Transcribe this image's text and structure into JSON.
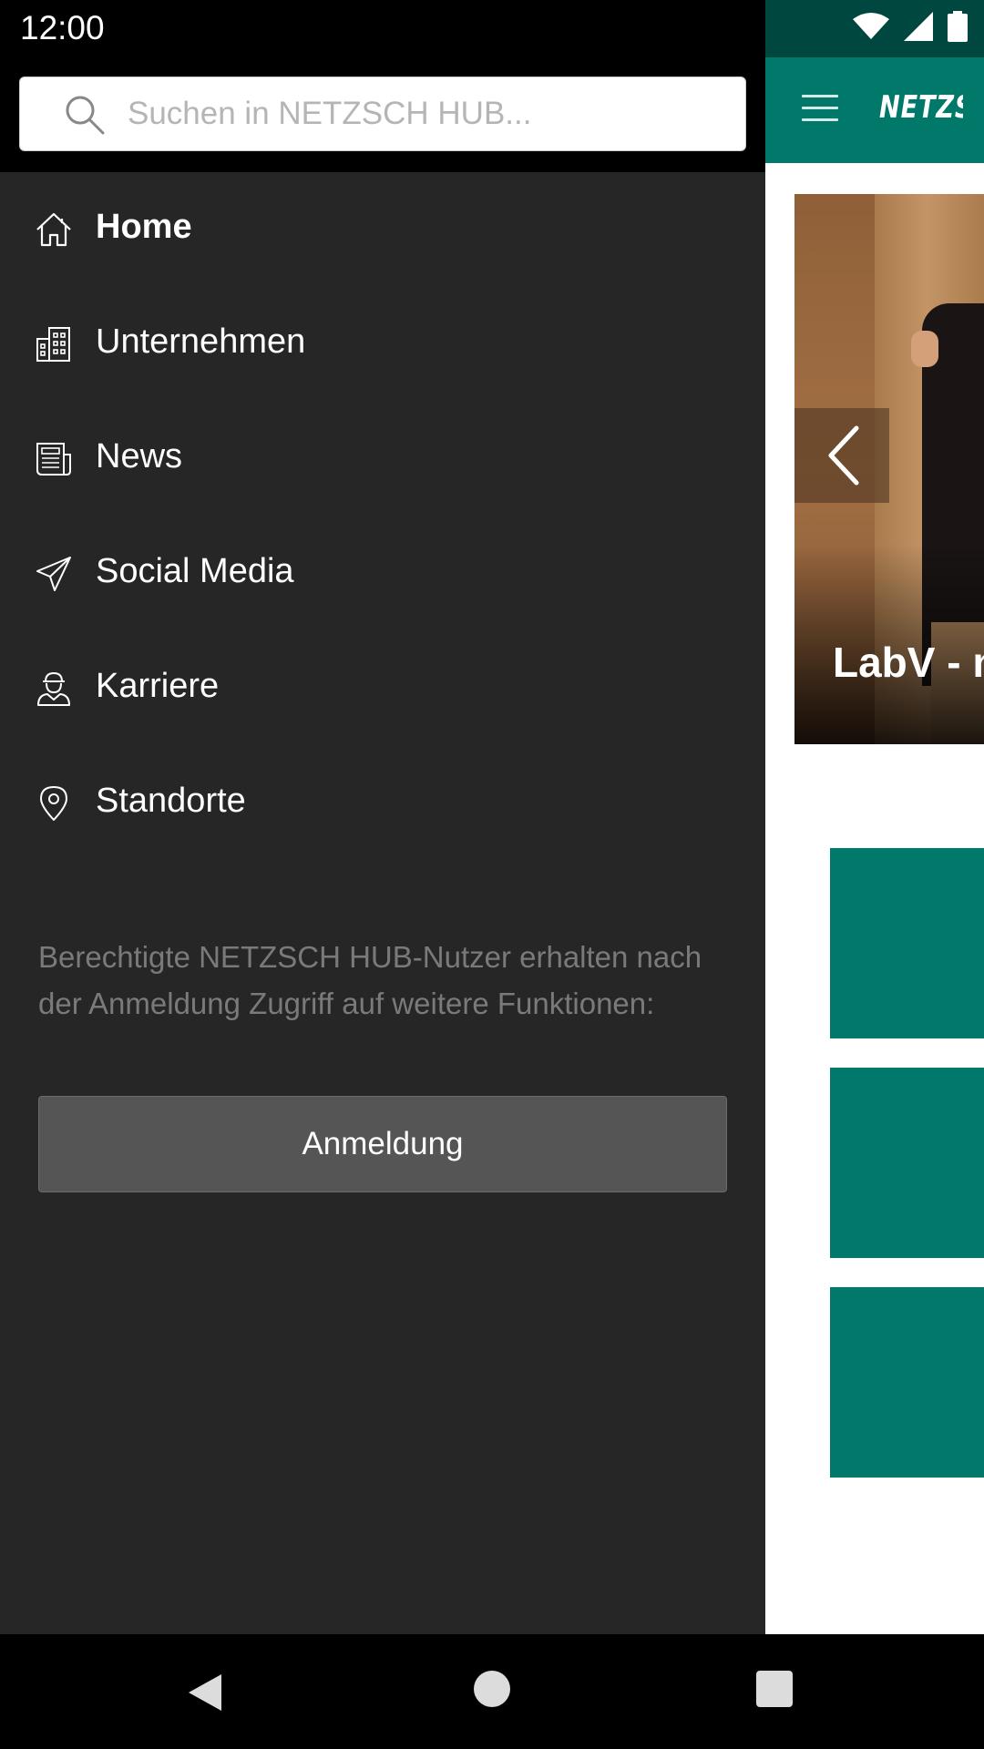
{
  "status_bar": {
    "time": "12:00"
  },
  "app": {
    "brand": "NETZSCH",
    "banner_title": "LabV - n",
    "header_color": "#00796b"
  },
  "drawer": {
    "search": {
      "placeholder": "Suchen in NETZSCH HUB..."
    },
    "items": [
      {
        "label": "Home",
        "icon": "home-icon",
        "active": true
      },
      {
        "label": "Unternehmen",
        "icon": "building-icon",
        "active": false
      },
      {
        "label": "News",
        "icon": "newspaper-icon",
        "active": false
      },
      {
        "label": "Social Media",
        "icon": "paper-plane-icon",
        "active": false
      },
      {
        "label": "Karriere",
        "icon": "worker-icon",
        "active": false
      },
      {
        "label": "Standorte",
        "icon": "location-pin-icon",
        "active": false
      }
    ],
    "hint": "Berechtigte NETZSCH HUB-Nutzer erhalten nach der Anmeldung Zugriff auf weitere Funktionen:",
    "login_label": "Anmeldung"
  }
}
